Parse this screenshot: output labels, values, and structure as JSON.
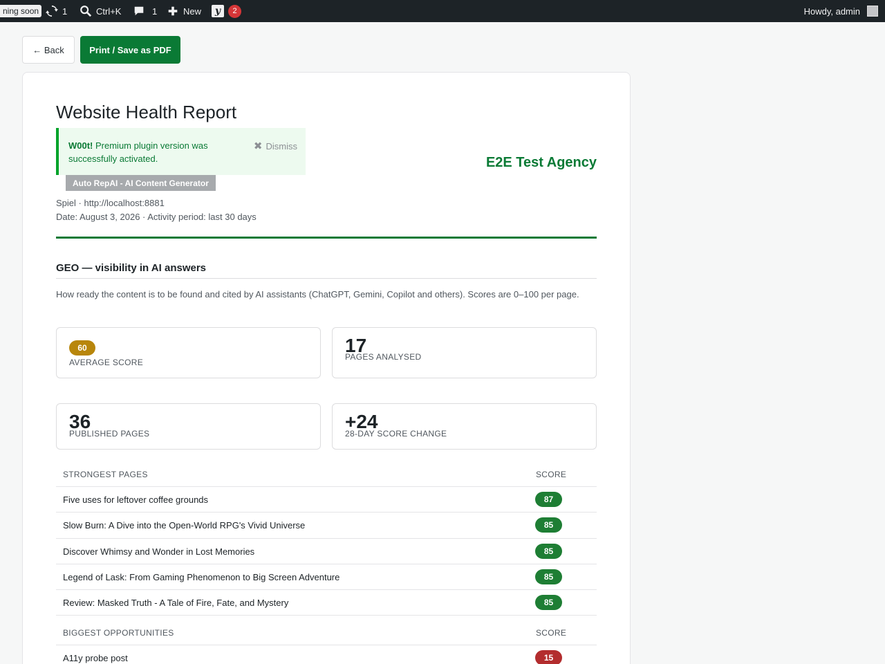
{
  "adminbar": {
    "coming_soon": "ning soon",
    "updates_count": "1",
    "search_shortcut": "Ctrl+K",
    "comments_count": "1",
    "new_label": "New",
    "yoast_logo": "y",
    "yoast_badge": "2",
    "howdy": "Howdy, admin"
  },
  "actions": {
    "back_label": "← Back",
    "print_label": "Print / Save as PDF"
  },
  "report": {
    "title": "Website Health Report",
    "notice": {
      "strong": "W00t!",
      "message": " Premium plugin version was successfully activated.",
      "dismiss_label": "Dismiss"
    },
    "plugin_tag": "Auto RepAI - AI Content Generator",
    "agency": "E2E Test Agency",
    "site_line": "Spiel · http://localhost:8881",
    "date_line": "Date: August 3, 2026 · Activity period: last 30 days",
    "geo": {
      "heading": "GEO — visibility in AI answers",
      "description": "How ready the content is to be found and cited by AI assistants (ChatGPT, Gemini, Copilot and others). Scores are 0–100 per page.",
      "stats": {
        "avg_score_value": "60",
        "avg_score_label": "Average score",
        "pages_analysed_value": "17",
        "pages_analysed_label": "Pages analysed",
        "published_pages_value": "36",
        "published_pages_label": "Published pages",
        "score_change_value": "+24",
        "score_change_label": "28-day score change"
      },
      "strongest": {
        "header": "Strongest pages",
        "score_header": "Score",
        "rows": [
          {
            "title": "Five uses for leftover coffee grounds",
            "score": "87"
          },
          {
            "title": "Slow Burn: A Dive into the Open-World RPG's Vivid Universe",
            "score": "85"
          },
          {
            "title": "Discover Whimsy and Wonder in Lost Memories",
            "score": "85"
          },
          {
            "title": "Legend of Lask: From Gaming Phenomenon to Big Screen Adventure",
            "score": "85"
          },
          {
            "title": "Review: Masked Truth - A Tale of Fire, Fate, and Mystery",
            "score": "85"
          }
        ]
      },
      "opportunities": {
        "header": "Biggest opportunities",
        "score_header": "Score",
        "rows": [
          {
            "title": "A11y probe post",
            "score": "15"
          }
        ]
      }
    }
  },
  "colors": {
    "brand_green": "#0a7a35",
    "score_good": "#1e7e34",
    "score_bad": "#b32d2e",
    "score_average": "#b8860b",
    "adminbar_bg": "#1d2327"
  }
}
